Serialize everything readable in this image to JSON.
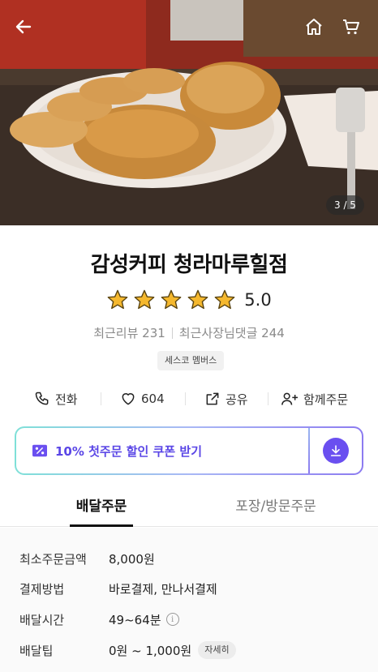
{
  "hero": {
    "page_indicator": "3 / 5",
    "icons": {
      "back": "back-arrow-icon",
      "home": "home-icon",
      "cart": "cart-icon"
    }
  },
  "store": {
    "name": "감성커피 청라마루힐점",
    "rating_value": "5.0",
    "rating_stars": 5,
    "recent_reviews": "최근리뷰 231",
    "owner_replies": "최근사장님댓글 244",
    "member_tag": "세스코 멤버스"
  },
  "actions": {
    "call": "전화",
    "likes": "604",
    "share": "공유",
    "group_order": "함께주문"
  },
  "coupon": {
    "text": "10% 첫주문 할인 쿠폰 받기"
  },
  "tabs": {
    "delivery": "배달주문",
    "pickup": "포장/방문주문"
  },
  "delivery_info": {
    "min_order_label": "최소주문금액",
    "min_order_value": "8,000원",
    "payment_label": "결제방법",
    "payment_value": "바로결제, 만나서결제",
    "time_label": "배달시간",
    "time_value": "49~64분",
    "tip_label": "배달팁",
    "tip_value": "0원 ~ 1,000원",
    "tip_detail": "자세히"
  },
  "colors": {
    "accent": "#5a46e6",
    "star": "#f5b82e",
    "coupon_gradient_start": "#7fe0d8",
    "coupon_gradient_end": "#8c7bf0"
  }
}
